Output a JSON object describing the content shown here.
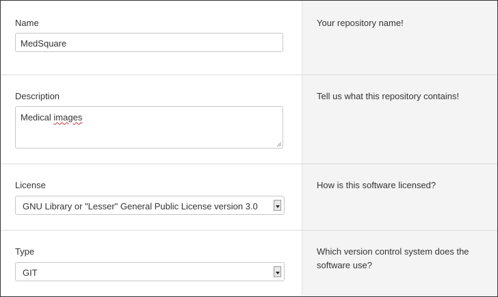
{
  "name": {
    "label": "Name",
    "value": "MedSquare",
    "hint": "Your repository name!"
  },
  "description": {
    "label": "Description",
    "value_prefix": "Medical ",
    "value_misspelled": "images",
    "hint": "Tell us what this repository contains!"
  },
  "license": {
    "label": "License",
    "selected": "GNU Library or \"Lesser\" General Public License version 3.0",
    "hint": "How is this software licensed?"
  },
  "type": {
    "label": "Type",
    "selected": "GIT",
    "hint": "Which version control system does the software use?"
  }
}
